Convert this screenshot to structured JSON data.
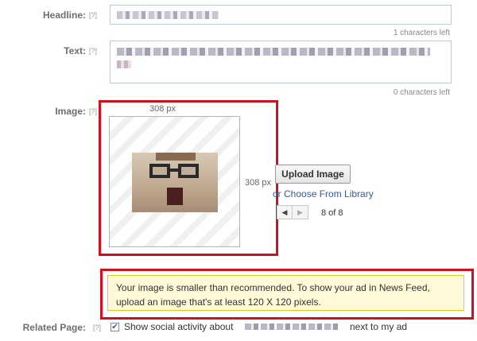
{
  "headline": {
    "label": "Headline:",
    "help": "[?]",
    "counter": "1 characters left"
  },
  "text": {
    "label": "Text:",
    "help": "[?]",
    "counter": "0 characters left"
  },
  "image": {
    "label": "Image:",
    "help": "[?]",
    "width_label": "308 px",
    "height_label": "308 px",
    "upload_button": "Upload Image",
    "library_link": "or Choose From Library",
    "pagination": "8 of 8"
  },
  "warning": {
    "line1": "Your image is smaller than recommended. To show your ad in News Feed,",
    "line2": "upload an image that's at least 120 X 120 pixels."
  },
  "related_page": {
    "label": "Related Page:",
    "help": "[?]",
    "checkbox_checked": true,
    "text_before": "Show social activity about",
    "text_after": "next to my ad"
  },
  "colors": {
    "highlight_red": "#d0101d",
    "link_blue": "#3b5998",
    "warning_bg": "#fff9d7"
  }
}
